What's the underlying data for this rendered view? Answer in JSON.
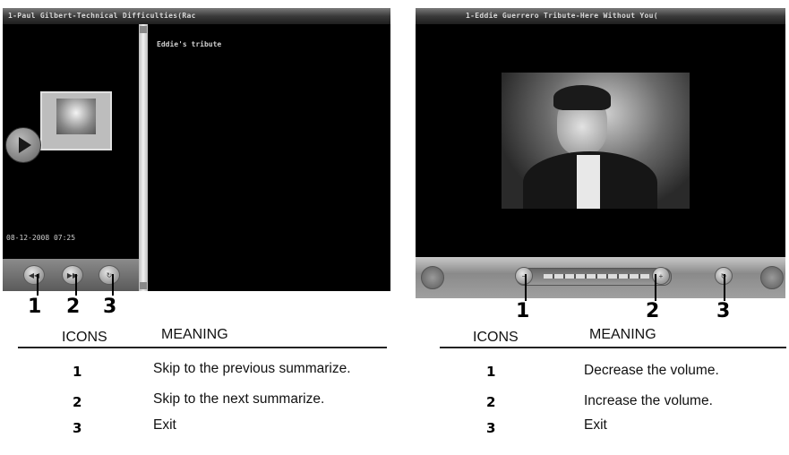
{
  "left_panel": {
    "title": "1-Paul Gilbert-Technical Difficulties(Rac",
    "text_content": "Eddie's tribute",
    "datetime": "08-12-2008 07:25",
    "callouts": [
      "1",
      "2",
      "3"
    ],
    "table": {
      "header_icons": "ICONS",
      "header_meaning": "MEANING",
      "rows": [
        {
          "icon": "1",
          "meaning": "Skip to the previous summarize."
        },
        {
          "icon": "2",
          "meaning": "Skip to the next summarize."
        },
        {
          "icon": "3",
          "meaning": "Exit"
        }
      ]
    }
  },
  "right_panel": {
    "title": "1-Eddie Guerrero Tribute-Here Without You(",
    "callouts": [
      "1",
      "2",
      "3"
    ],
    "table": {
      "header_icons": "ICONS",
      "header_meaning": "MEANING",
      "rows": [
        {
          "icon": "1",
          "meaning": "Decrease the volume."
        },
        {
          "icon": "2",
          "meaning": "Increase the volume."
        },
        {
          "icon": "3",
          "meaning": "Exit"
        }
      ]
    }
  },
  "icons": {
    "play": "play-icon",
    "prev": "previous-icon",
    "next": "next-icon",
    "exit": "exit-icon",
    "vol_down": "volume-down-icon",
    "vol_up": "volume-up-icon"
  }
}
